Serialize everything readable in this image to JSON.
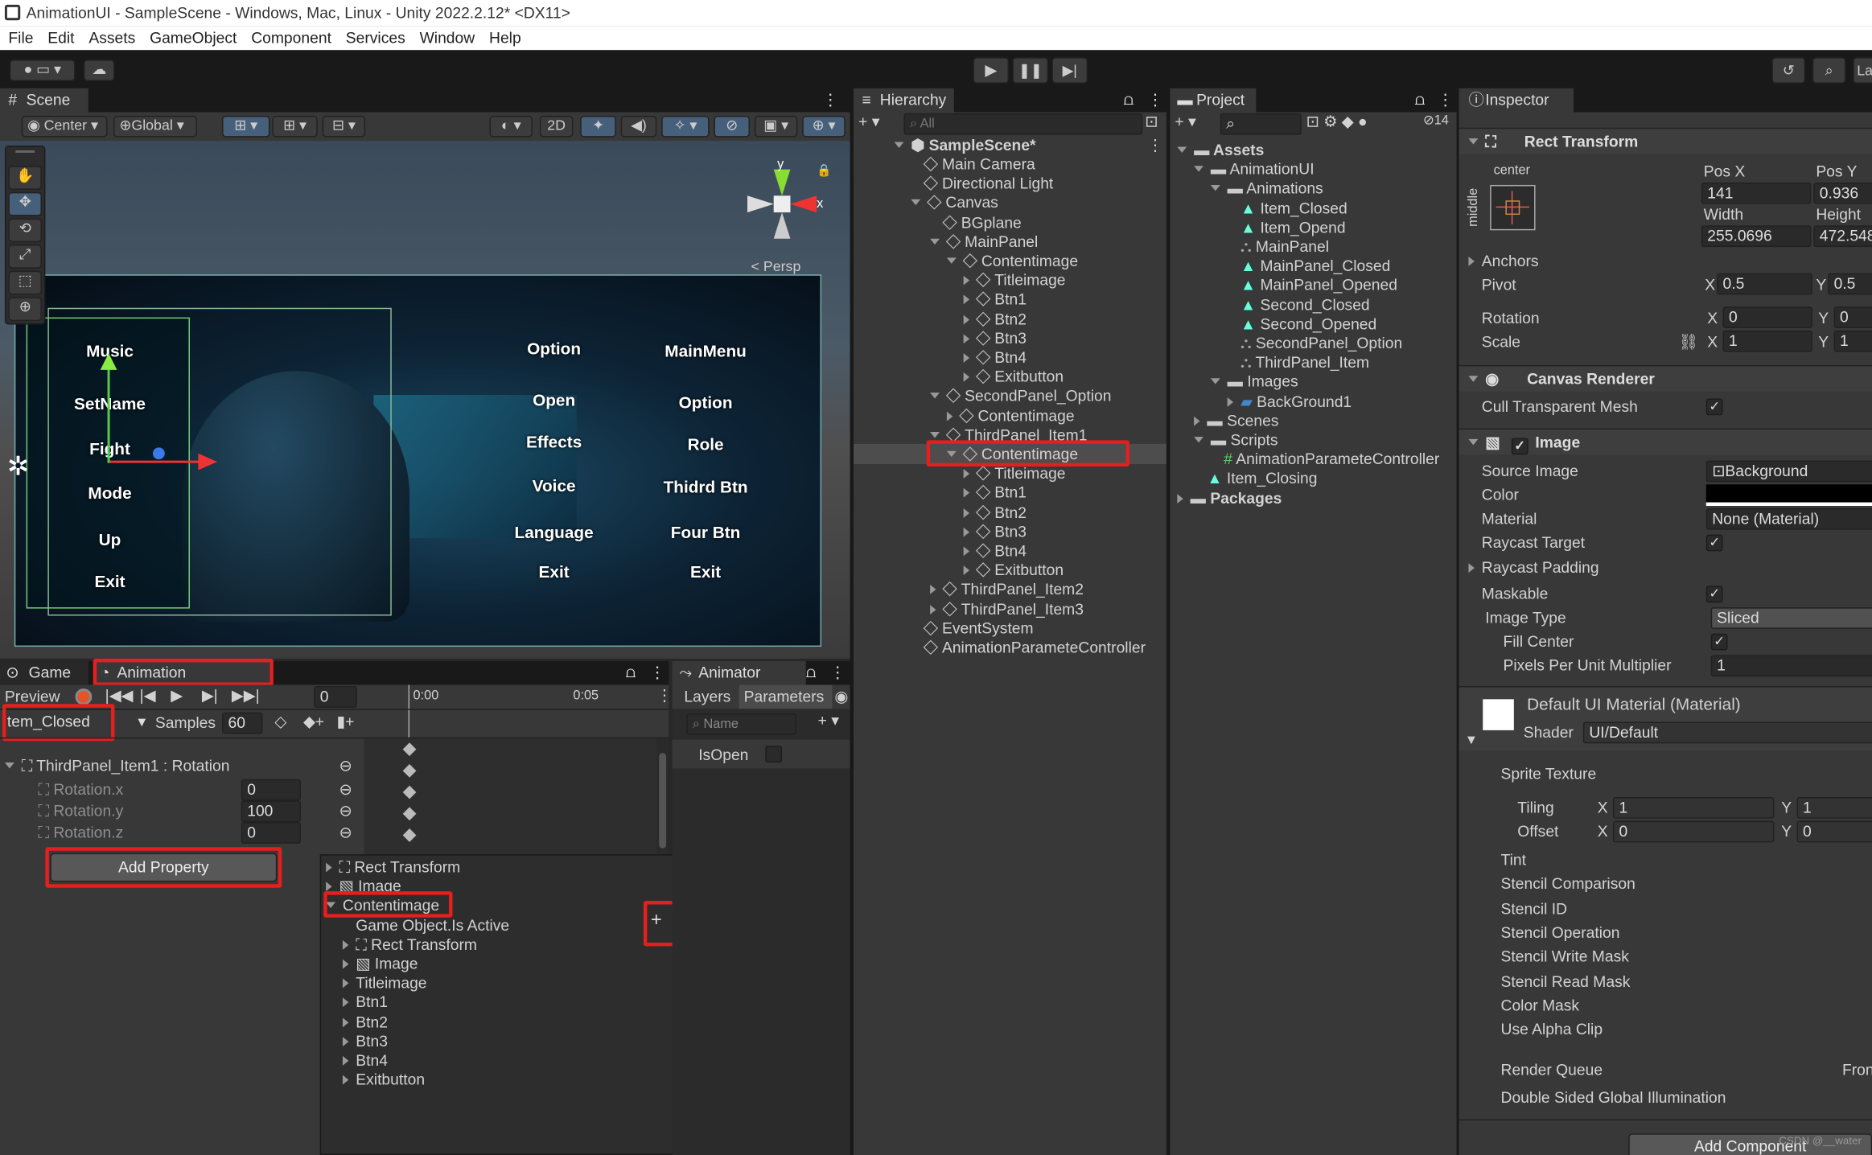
{
  "window": {
    "title": "AnimationUI - SampleScene - Windows, Mac, Linux - Unity 2022.2.12* <DX11>"
  },
  "menu": [
    "File",
    "Edit",
    "Assets",
    "GameObject",
    "Component",
    "Services",
    "Window",
    "Help"
  ],
  "toolbar": {
    "layers_trunc": "La"
  },
  "scene": {
    "tab": "Scene",
    "pivot": "Center",
    "space": "Global",
    "mode2d": "2D",
    "persp": "< Persp",
    "axis_x": "x",
    "axis_y": "y",
    "left_menu": [
      "Music",
      "SetName",
      "Fight",
      "Mode",
      "Up",
      "Exit"
    ],
    "mid_menu": [
      "Option",
      "Open",
      "Effects",
      "Voice",
      "Language",
      "Exit"
    ],
    "right_menu": [
      "MainMenu",
      "Option",
      "Role",
      "Thidrd Btn",
      "Four Btn",
      "Exit"
    ]
  },
  "hierarchy": {
    "tab": "Hierarchy",
    "search": "All",
    "scene": "SampleScene*",
    "items": [
      {
        "t": "Main Camera",
        "d": 1,
        "a": ""
      },
      {
        "t": "Directional Light",
        "d": 1,
        "a": ""
      },
      {
        "t": "Canvas",
        "d": 1,
        "a": "open"
      },
      {
        "t": "BGplane",
        "d": 2,
        "a": ""
      },
      {
        "t": "MainPanel",
        "d": 2,
        "a": "open"
      },
      {
        "t": "Contentimage",
        "d": 3,
        "a": "open"
      },
      {
        "t": "Titleimage",
        "d": 4,
        "a": "closed"
      },
      {
        "t": "Btn1",
        "d": 4,
        "a": "closed"
      },
      {
        "t": "Btn2",
        "d": 4,
        "a": "closed"
      },
      {
        "t": "Btn3",
        "d": 4,
        "a": "closed"
      },
      {
        "t": "Btn4",
        "d": 4,
        "a": "closed"
      },
      {
        "t": "Exitbutton",
        "d": 4,
        "a": "closed"
      },
      {
        "t": "SecondPanel_Option",
        "d": 2,
        "a": "open"
      },
      {
        "t": "Contentimage",
        "d": 3,
        "a": "closed"
      },
      {
        "t": "ThirdPanel_Item1",
        "d": 2,
        "a": "open"
      },
      {
        "t": "Contentimage",
        "d": 3,
        "a": "open"
      },
      {
        "t": "Titleimage",
        "d": 4,
        "a": "closed"
      },
      {
        "t": "Btn1",
        "d": 4,
        "a": "closed"
      },
      {
        "t": "Btn2",
        "d": 4,
        "a": "closed"
      },
      {
        "t": "Btn3",
        "d": 4,
        "a": "closed"
      },
      {
        "t": "Btn4",
        "d": 4,
        "a": "closed"
      },
      {
        "t": "Exitbutton",
        "d": 4,
        "a": "closed"
      },
      {
        "t": "ThirdPanel_Item2",
        "d": 2,
        "a": "closed"
      },
      {
        "t": "ThirdPanel_Item3",
        "d": 2,
        "a": "closed"
      },
      {
        "t": "EventSystem",
        "d": 1,
        "a": ""
      },
      {
        "t": "AnimationParameteController",
        "d": 1,
        "a": ""
      }
    ]
  },
  "project": {
    "tab": "Project",
    "count": "14",
    "items": [
      {
        "t": "Assets",
        "d": 0,
        "k": "folder",
        "a": "open"
      },
      {
        "t": "AnimationUI",
        "d": 1,
        "k": "folder",
        "a": "open"
      },
      {
        "t": "Animations",
        "d": 2,
        "k": "folder",
        "a": "open"
      },
      {
        "t": "Item_Closed",
        "d": 3,
        "k": "anim",
        "a": ""
      },
      {
        "t": "Item_Opend",
        "d": 3,
        "k": "anim",
        "a": ""
      },
      {
        "t": "MainPanel",
        "d": 3,
        "k": "ctrl",
        "a": ""
      },
      {
        "t": "MainPanel_Closed",
        "d": 3,
        "k": "anim",
        "a": ""
      },
      {
        "t": "MainPanel_Opened",
        "d": 3,
        "k": "anim",
        "a": ""
      },
      {
        "t": "Second_Closed",
        "d": 3,
        "k": "anim",
        "a": ""
      },
      {
        "t": "Second_Opened",
        "d": 3,
        "k": "anim",
        "a": ""
      },
      {
        "t": "SecondPanel_Option",
        "d": 3,
        "k": "ctrl",
        "a": ""
      },
      {
        "t": "ThirdPanel_Item",
        "d": 3,
        "k": "ctrl",
        "a": ""
      },
      {
        "t": "Images",
        "d": 2,
        "k": "folder",
        "a": "open"
      },
      {
        "t": "BackGround1",
        "d": 3,
        "k": "img",
        "a": "closed"
      },
      {
        "t": "Scenes",
        "d": 1,
        "k": "folder",
        "a": "closed"
      },
      {
        "t": "Scripts",
        "d": 1,
        "k": "folder",
        "a": "open"
      },
      {
        "t": "AnimationParameteController",
        "d": 2,
        "k": "script",
        "a": ""
      },
      {
        "t": "Item_Closing",
        "d": 1,
        "k": "anim",
        "a": ""
      },
      {
        "t": "Packages",
        "d": 0,
        "k": "folder",
        "a": "closed"
      }
    ]
  },
  "inspector": {
    "tab": "Inspector",
    "rect": {
      "title": "Rect Transform",
      "anchor": "center",
      "anchor_v": "middle",
      "posx_l": "Pos X",
      "posy_l": "Pos Y",
      "posx": "141",
      "posy": "0.936",
      "w_l": "Width",
      "h_l": "Height",
      "w": "255.0696",
      "h": "472.548",
      "anchors": "Anchors",
      "pivot": "Pivot",
      "px": "0.5",
      "py": "0.5",
      "rotation": "Rotation",
      "rx": "0",
      "ry": "0",
      "scale": "Scale",
      "sx": "1",
      "sy": "1",
      "X": "X",
      "Y": "Y"
    },
    "canvas_renderer": {
      "title": "Canvas Renderer",
      "cull": "Cull Transparent Mesh"
    },
    "image": {
      "title": "Image",
      "source_l": "Source Image",
      "source": "Background",
      "color_l": "Color",
      "material_l": "Material",
      "material": "None (Material)",
      "raycast": "Raycast Target",
      "raycast_pad": "Raycast Padding",
      "maskable": "Maskable",
      "type_l": "Image Type",
      "type": "Sliced",
      "fill": "Fill Center",
      "ppu_l": "Pixels Per Unit Multiplier",
      "ppu": "1"
    },
    "mat": {
      "title": "Default UI Material (Material)",
      "shader_l": "Shader",
      "shader": "UI/Default",
      "sprite": "Sprite Texture",
      "tiling": "Tiling",
      "offset": "Offset",
      "t1": "1",
      "t2": "1",
      "o1": "0",
      "o2": "0",
      "props": [
        "Tint",
        "Stencil Comparison",
        "Stencil ID",
        "Stencil Operation",
        "Stencil Write Mask",
        "Stencil Read Mask",
        "Color Mask",
        "Use Alpha Clip"
      ],
      "queue": "Render Queue",
      "queue_v": "Fron",
      "dsgi": "Double Sided Global Illumination"
    },
    "add_component": "Add Component",
    "watermark": "CSDN @__water"
  },
  "animation": {
    "tab_game": "Game",
    "tab_anim": "Animation",
    "preview": "Preview",
    "frame": "0",
    "t0": "0:00",
    "t1": "0:05",
    "clip": "tem_Closed",
    "samples_l": "Samples",
    "samples": "60",
    "prop_group": "ThirdPanel_Item1 : Rotation",
    "props": [
      {
        "n": "Rotation.x",
        "v": "0"
      },
      {
        "n": "Rotation.y",
        "v": "100"
      },
      {
        "n": "Rotation.z",
        "v": "0"
      }
    ],
    "add_property": "Add Property",
    "popup": [
      {
        "t": "Rect Transform",
        "d": 0,
        "a": "closed",
        "i": "rect"
      },
      {
        "t": "Image",
        "d": 0,
        "a": "closed",
        "i": "img"
      },
      {
        "t": "Contentimage",
        "d": 0,
        "a": "open",
        "i": ""
      },
      {
        "t": "Game Object.Is Active",
        "d": 1,
        "a": "",
        "i": ""
      },
      {
        "t": "Rect Transform",
        "d": 1,
        "a": "closed",
        "i": "rect"
      },
      {
        "t": "Image",
        "d": 1,
        "a": "closed",
        "i": "img"
      },
      {
        "t": "Titleimage",
        "d": 1,
        "a": "closed",
        "i": ""
      },
      {
        "t": "Btn1",
        "d": 1,
        "a": "closed",
        "i": ""
      },
      {
        "t": "Btn2",
        "d": 1,
        "a": "closed",
        "i": ""
      },
      {
        "t": "Btn3",
        "d": 1,
        "a": "closed",
        "i": ""
      },
      {
        "t": "Btn4",
        "d": 1,
        "a": "closed",
        "i": ""
      },
      {
        "t": "Exitbutton",
        "d": 1,
        "a": "closed",
        "i": ""
      }
    ],
    "plus": "+"
  },
  "animator": {
    "tab": "Animator",
    "layers": "Layers",
    "parameters": "Parameters",
    "search": "Name",
    "param": "IsOpen"
  }
}
